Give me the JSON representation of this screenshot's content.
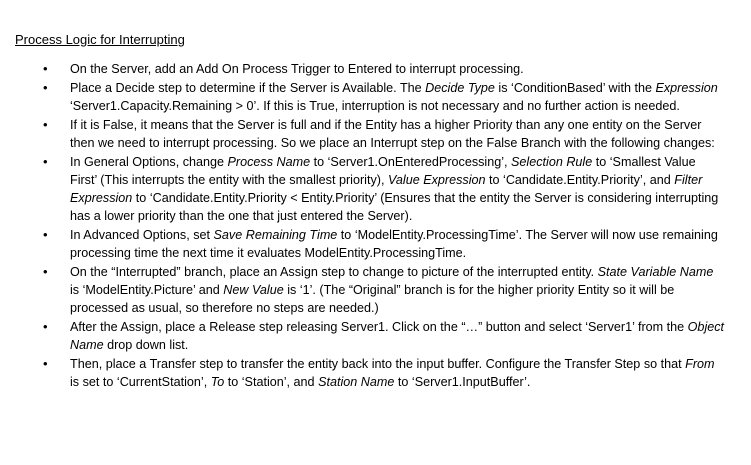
{
  "heading": "Process Logic for Interrupting",
  "bullet_glyph": "•",
  "bullets": [
    {
      "segments": [
        {
          "text": "On the Server, add an Add On Process Trigger to Entered to interrupt processing.",
          "italic": false
        }
      ]
    },
    {
      "segments": [
        {
          "text": "Place a Decide step to determine if the Server is Available.  The ",
          "italic": false
        },
        {
          "text": "Decide Type",
          "italic": true
        },
        {
          "text": " is ‘ConditionBased’ with the ",
          "italic": false
        },
        {
          "text": "Expression",
          "italic": true
        },
        {
          "text": " ‘Server1.Capacity.Remaining > 0’.  If this is True, interruption is not necessary and no further action is needed.",
          "italic": false
        }
      ]
    },
    {
      "segments": [
        {
          "text": "If it is False, it means that the Server is full and if the Entity has a higher Priority than any one entity on the Server then we need to interrupt processing.  So we place an Interrupt step on the False Branch with the following changes:",
          "italic": false
        }
      ]
    },
    {
      "segments": [
        {
          "text": "In General Options, change ",
          "italic": false
        },
        {
          "text": "Process Name",
          "italic": true
        },
        {
          "text": " to ‘Server1.OnEnteredProcessing’, ",
          "italic": false
        },
        {
          "text": "Selection Rule",
          "italic": true
        },
        {
          "text": " to ‘Smallest Value First’  (This interrupts the entity with the smallest  priority), ",
          "italic": false
        },
        {
          "text": "Value Expression",
          "italic": true
        },
        {
          "text": " to ‘Candidate.Entity.Priority’, and ",
          "italic": false
        },
        {
          "text": "Filter Expression",
          "italic": true
        },
        {
          "text": " to ‘Candidate.Entity.Priority < Entity.Priority’ (Ensures that the entity the Server is considering interrupting has a lower priority than the one that just entered the Server).",
          "italic": false
        }
      ]
    },
    {
      "segments": [
        {
          "text": "In Advanced Options, set ",
          "italic": false
        },
        {
          "text": "Save Remaining Time",
          "italic": true
        },
        {
          "text": " to ‘ModelEntity.ProcessingTime’. The Server will now use remaining processing time the next time it evaluates ModelEntity.ProcessingTime.",
          "italic": false
        }
      ]
    },
    {
      "segments": [
        {
          "text": "On the “Interrupted” branch, place an Assign step to change to picture of the interrupted entity.  ",
          "italic": false
        },
        {
          "text": "State Variable Name",
          "italic": true
        },
        {
          "text": " is ‘ModelEntity.Picture’ and ",
          "italic": false
        },
        {
          "text": "New Value",
          "italic": true
        },
        {
          "text": " is ‘1’. (The “Original” branch is for the higher priority Entity so it will be processed as usual, so therefore no steps are needed.)",
          "italic": false
        }
      ]
    },
    {
      "segments": [
        {
          "text": "After the Assign, place a Release step releasing Server1.  Click on the “…” button and select ‘Server1’ from the ",
          "italic": false
        },
        {
          "text": "Object Name",
          "italic": true
        },
        {
          "text": " drop down list.",
          "italic": false
        }
      ]
    },
    {
      "segments": [
        {
          "text": "Then, place a Transfer step to transfer the entity back into the input buffer.  Configure the Transfer Step so that ",
          "italic": false
        },
        {
          "text": "From",
          "italic": true
        },
        {
          "text": " is set to ‘CurrentStation’, ",
          "italic": false
        },
        {
          "text": "To",
          "italic": true
        },
        {
          "text": " to ‘Station’, and ",
          "italic": false
        },
        {
          "text": "Station Name",
          "italic": true
        },
        {
          "text": " to ‘Server1.InputBuffer’.",
          "italic": false
        }
      ]
    }
  ]
}
